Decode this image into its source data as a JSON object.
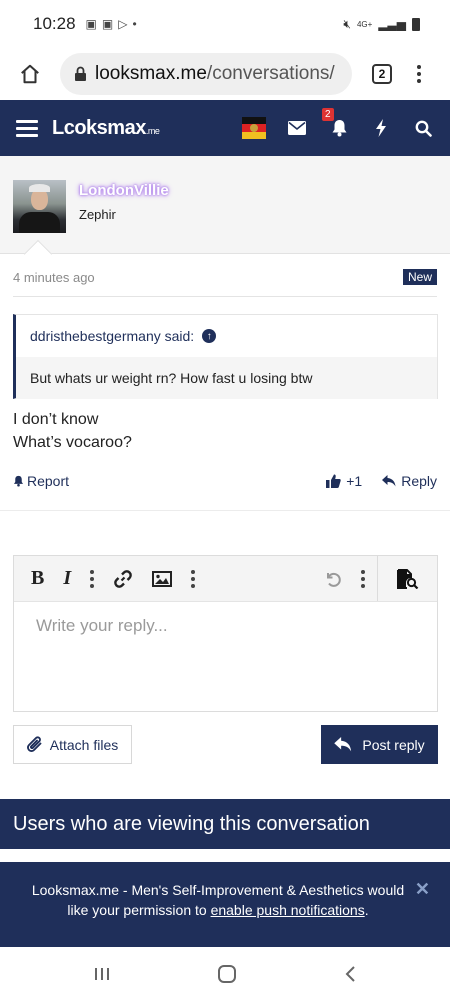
{
  "status_bar": {
    "time": "10:28",
    "network": "4G+"
  },
  "browser": {
    "url_host": "looksmax.me",
    "url_path": "/conversations/",
    "tab_count": "2"
  },
  "site": {
    "logo_text": "Lcoksmax",
    "logo_suffix": ".me",
    "alert_badge": "2"
  },
  "message": {
    "username": "LondonVillie",
    "user_title": "Zephir",
    "timestamp": "4 minutes ago",
    "new_label": "New",
    "quote_author": "ddristhebestgermany said:",
    "quote_text": "But whats ur weight rn? How fast u losing btw",
    "body_lines": [
      "I don’t know",
      "What’s vocaroo?"
    ],
    "report_label": "Report",
    "like_count": "+1",
    "reply_label": "Reply"
  },
  "editor": {
    "placeholder": "Write your reply...",
    "attach_label": "Attach files",
    "post_label": "Post reply"
  },
  "viewers_heading": "Users who are viewing this conversation",
  "push_notice": {
    "text_before": "Looksmax.me - Men's Self-Improvement & Aesthetics would like your permission to ",
    "link_text": "enable push notifications",
    "text_after": "."
  },
  "colors": {
    "brand_navy": "#1f2f5a",
    "username_glow": "#b98cf0",
    "badge_red": "#d33333"
  }
}
